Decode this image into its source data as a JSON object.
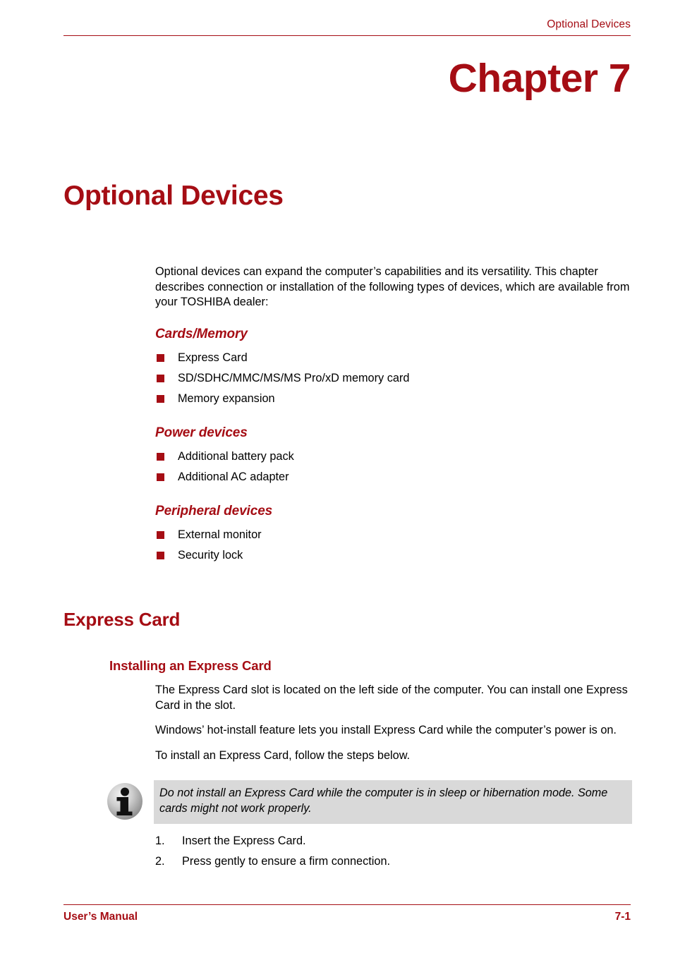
{
  "header": {
    "running_title": "Optional Devices"
  },
  "chapter": {
    "number_label": "Chapter 7",
    "title": "Optional Devices"
  },
  "intro": {
    "paragraph": "Optional devices can expand the computer’s capabilities and its versatility. This chapter describes connection or installation of the following types of devices, which are available from your TOSHIBA dealer:"
  },
  "groups": [
    {
      "heading": "Cards/Memory",
      "items": [
        "Express Card",
        "SD/SDHC/MMC/MS/MS Pro/xD memory card",
        "Memory expansion"
      ]
    },
    {
      "heading": "Power devices",
      "items": [
        "Additional battery pack",
        "Additional AC adapter"
      ]
    },
    {
      "heading": "Peripheral devices",
      "items": [
        "External monitor",
        "Security lock"
      ]
    }
  ],
  "section": {
    "heading": "Express Card",
    "subsection_heading": "Installing an Express Card",
    "paragraphs": [
      "The Express Card slot is located on the left side of the computer. You can install one Express Card in the slot.",
      "Windows’ hot-install feature lets you install Express Card while the computer’s power is on.",
      "To install an Express Card, follow the steps below."
    ]
  },
  "note": {
    "icon": "info-icon",
    "text": "Do not install an Express Card while the computer is in sleep or hibernation mode. Some cards might not work properly.",
    "background_color": "#D9D9D9"
  },
  "steps": [
    {
      "number": "1.",
      "text": "Insert the Express Card."
    },
    {
      "number": "2.",
      "text": "Press gently to ensure a firm connection."
    }
  ],
  "footer": {
    "left": "User’s Manual",
    "right": "7-1"
  },
  "colors": {
    "accent_red": "#A50D14",
    "note_gray": "#D9D9D9",
    "text_black": "#000000"
  }
}
